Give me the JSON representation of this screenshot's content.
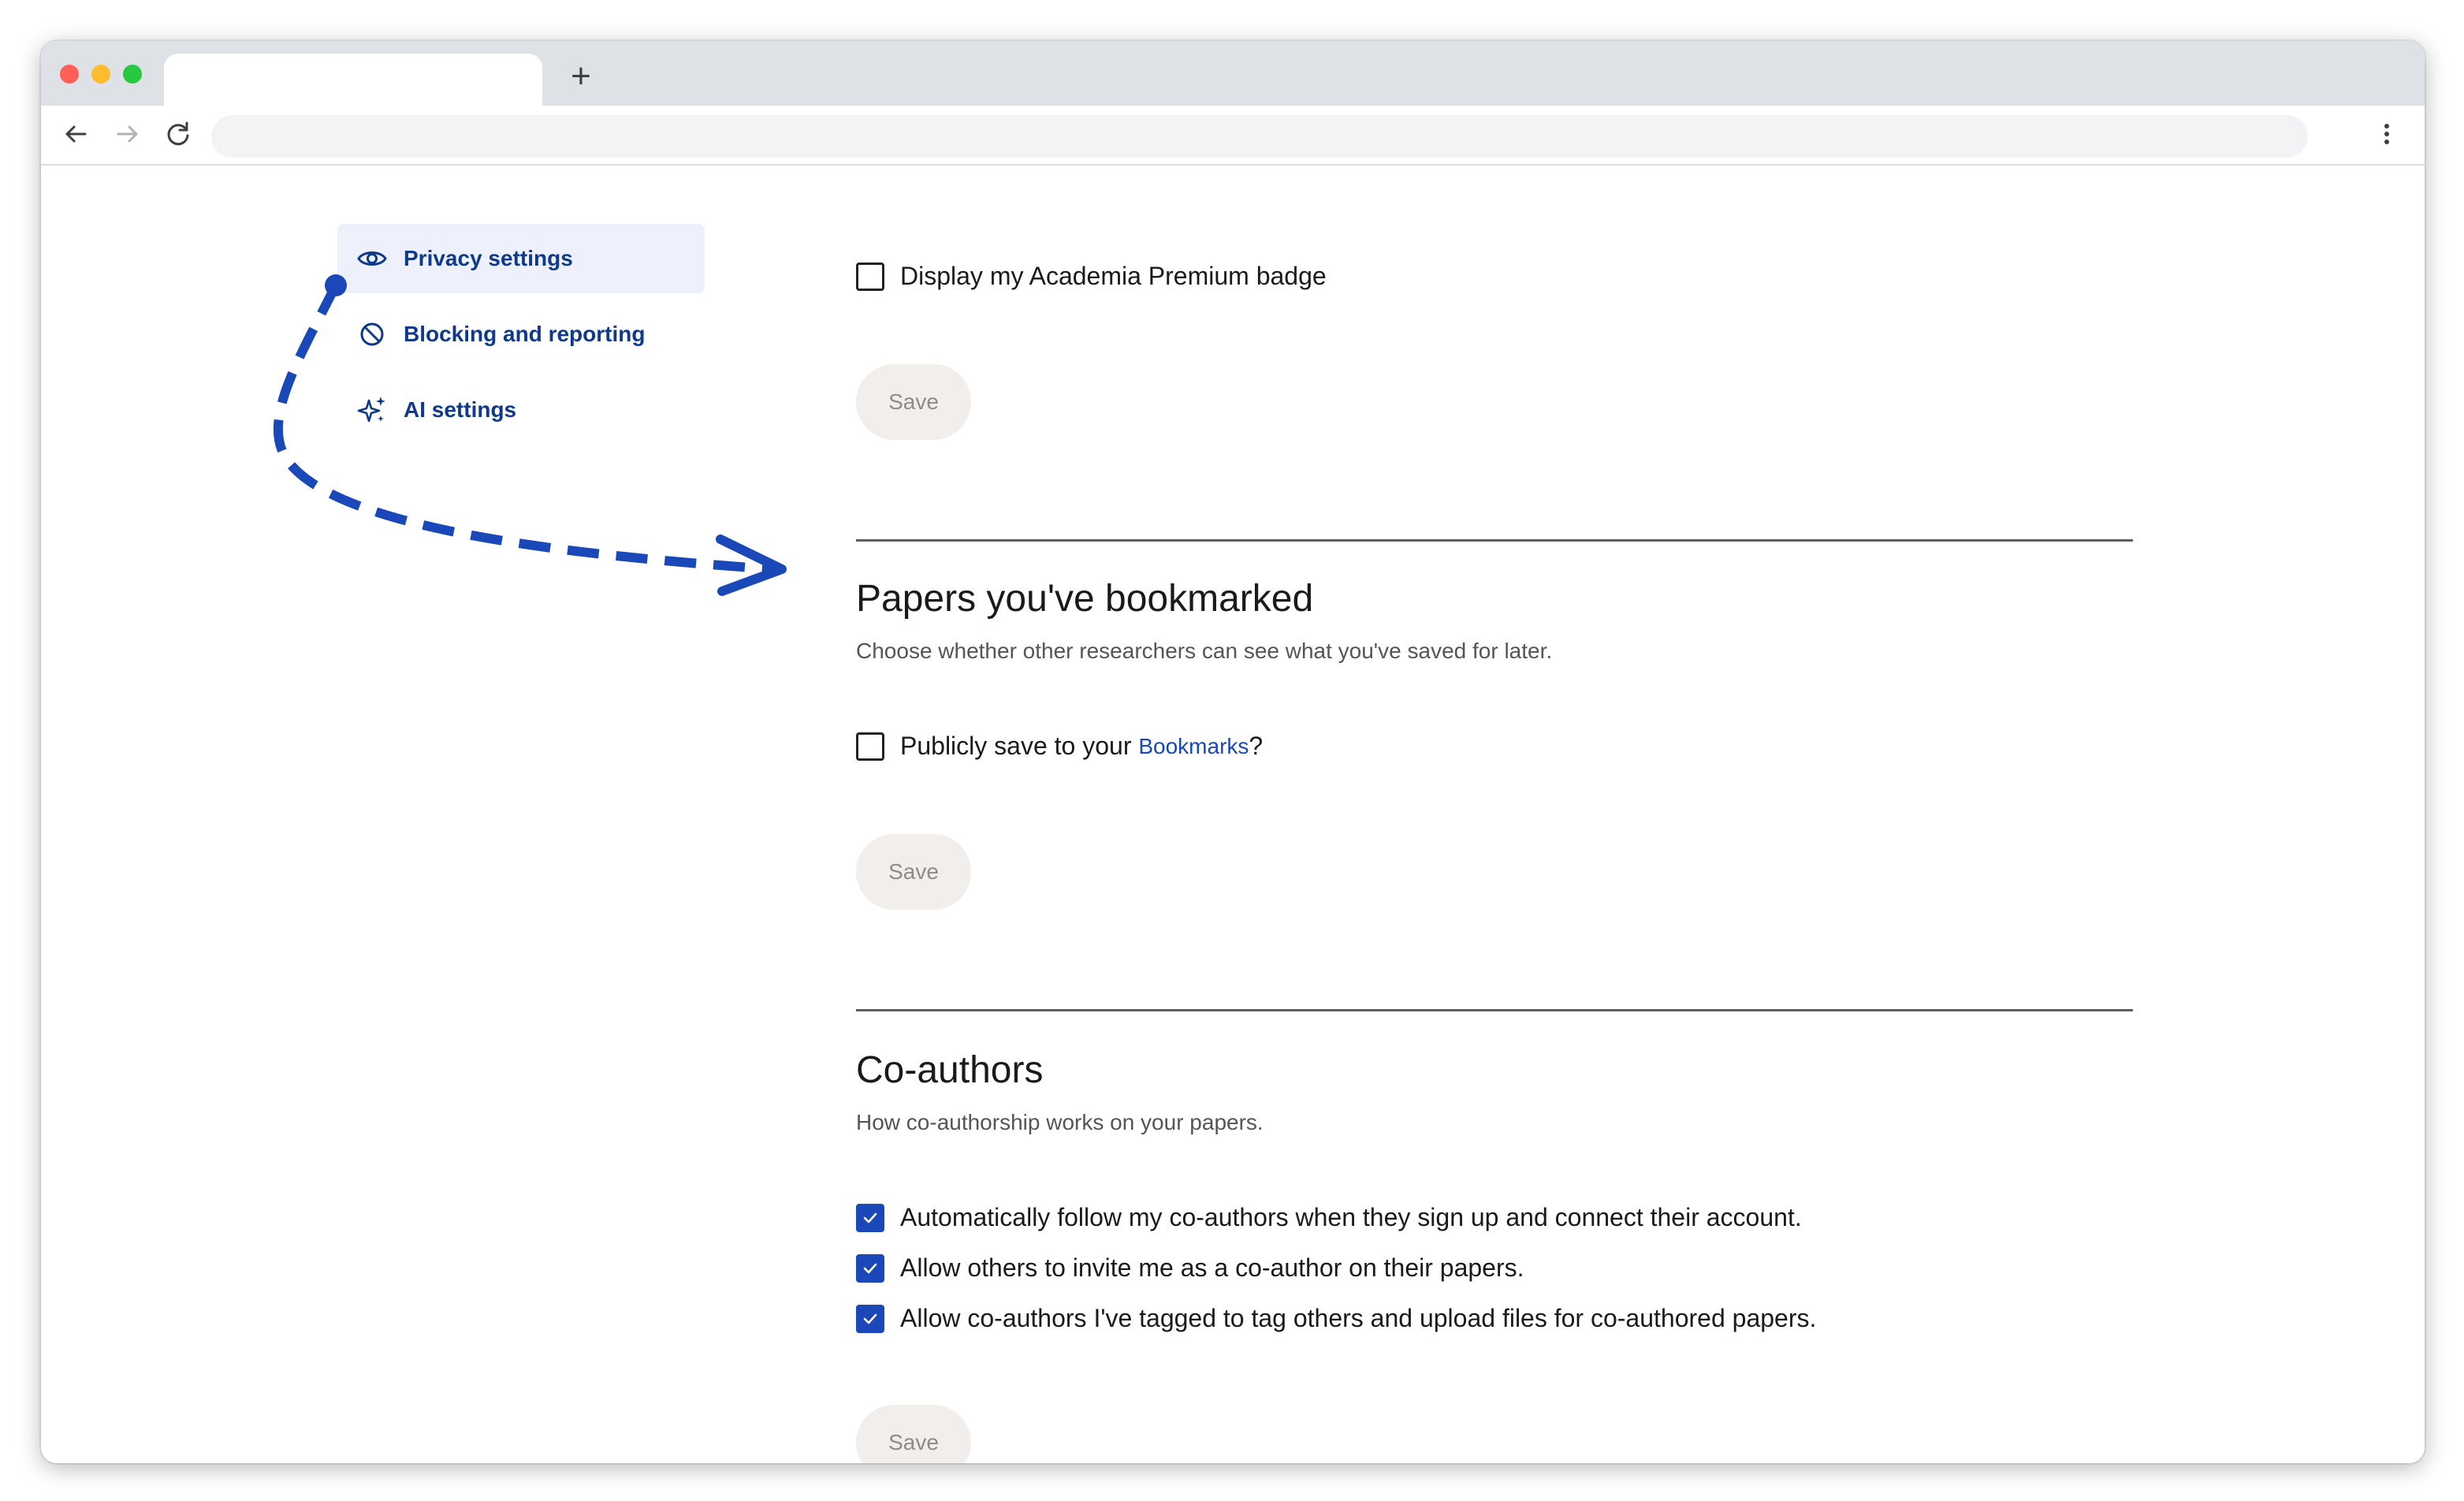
{
  "browser": {
    "new_tab_symbol": "+",
    "icons": [
      "back-arrow-icon",
      "forward-arrow-icon",
      "reload-icon",
      "kebab-menu-icon"
    ]
  },
  "sidebar": {
    "items": [
      {
        "label": "Privacy settings",
        "icon": "eye-icon",
        "active": true
      },
      {
        "label": "Blocking and reporting",
        "icon": "block-icon",
        "active": false
      },
      {
        "label": "AI settings",
        "icon": "sparkle-icon",
        "active": false
      }
    ]
  },
  "premium": {
    "badge_label": "Display my Academia Premium badge",
    "checked": false,
    "save_label": "Save"
  },
  "bookmarks": {
    "title": "Papers you've bookmarked",
    "description": "Choose whether other researchers can see what you've saved for later.",
    "option_prefix": "Publicly save to your ",
    "option_link": "Bookmarks",
    "option_suffix": "?",
    "checked": false,
    "save_label": "Save"
  },
  "coauthors": {
    "title": "Co-authors",
    "description": "How co-authorship works on your papers.",
    "options": [
      {
        "label": "Automatically follow my co-authors when they sign up and connect their account.",
        "checked": true
      },
      {
        "label": "Allow others to invite me as a co-author on their papers.",
        "checked": true
      },
      {
        "label": "Allow co-authors I've tagged to tag others and upload files for co-authored papers.",
        "checked": true
      }
    ],
    "save_label": "Save"
  },
  "colors": {
    "accent": "#1a48b8",
    "sidebar_text": "#0f3a8c",
    "active_bg": "#eef1fb",
    "save_bg": "#f2eeeb",
    "annotation": "#1a48b8"
  }
}
